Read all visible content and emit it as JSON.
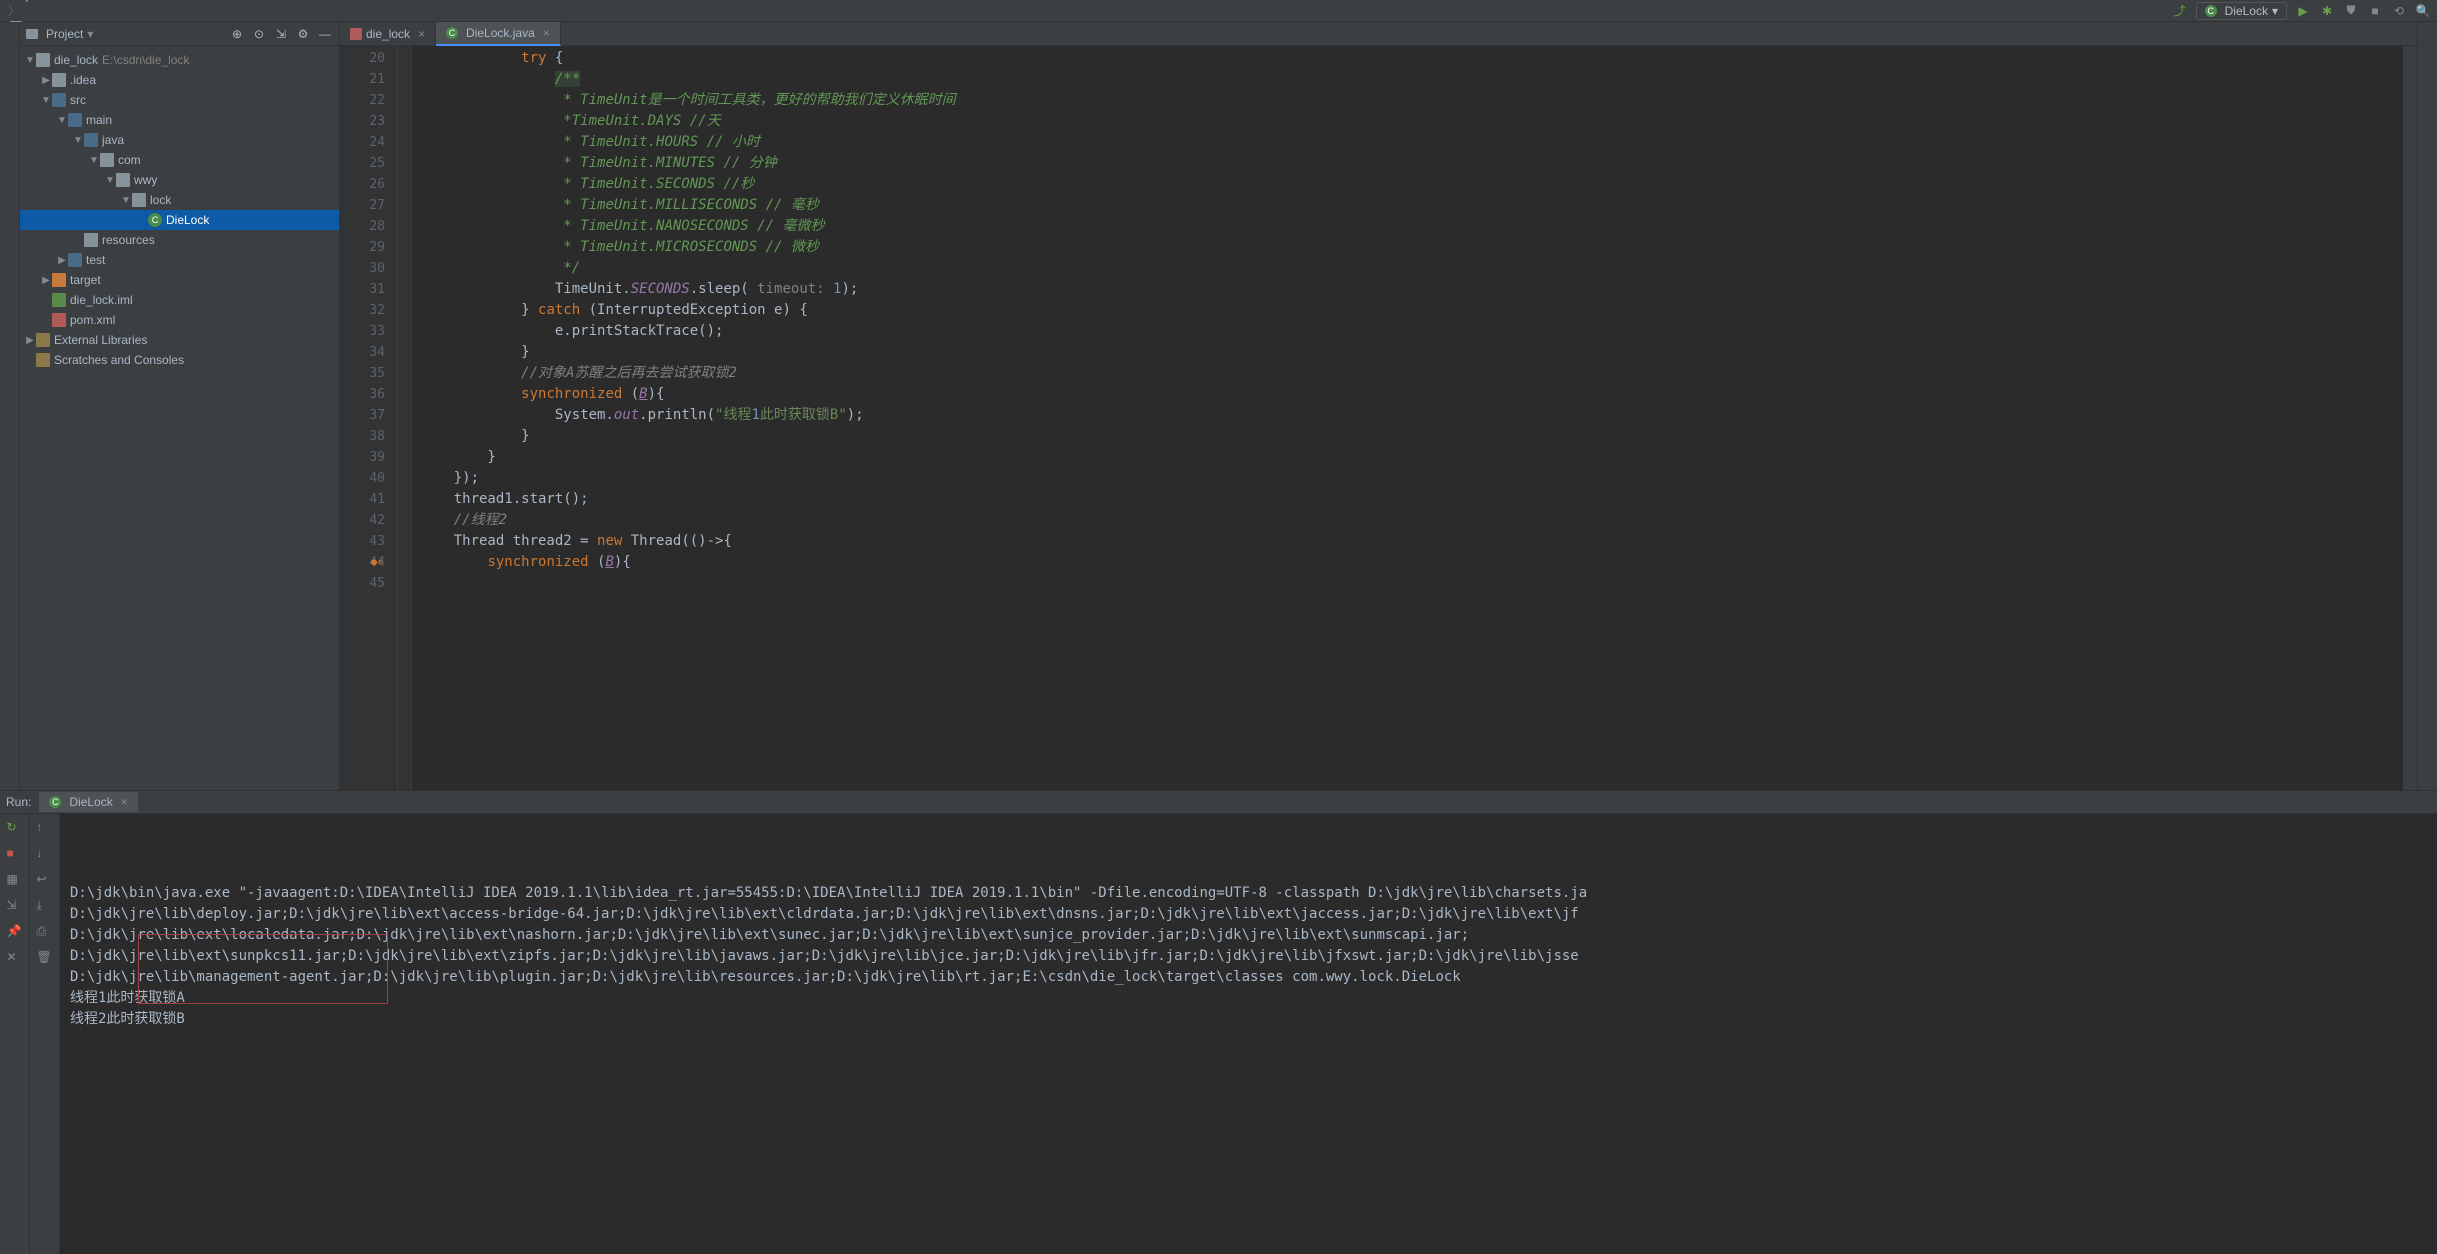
{
  "breadcrumbs": [
    "die_lock",
    "src",
    "main",
    "java",
    "com",
    "wwy",
    "lock",
    "DieLock"
  ],
  "run_config": "DieLock",
  "project_panel": {
    "title": "Project",
    "root_label": "die_lock",
    "root_path": "E:\\csdn\\die_lock",
    "tree": [
      {
        "indent": 1,
        "arrow": "▶",
        "icon": "folder",
        "label": ".idea"
      },
      {
        "indent": 1,
        "arrow": "▼",
        "icon": "folder-blue",
        "label": "src"
      },
      {
        "indent": 2,
        "arrow": "▼",
        "icon": "folder-blue",
        "label": "main"
      },
      {
        "indent": 3,
        "arrow": "▼",
        "icon": "folder-blue",
        "label": "java"
      },
      {
        "indent": 4,
        "arrow": "▼",
        "icon": "folder",
        "label": "com"
      },
      {
        "indent": 5,
        "arrow": "▼",
        "icon": "folder",
        "label": "wwy"
      },
      {
        "indent": 6,
        "arrow": "▼",
        "icon": "folder",
        "label": "lock"
      },
      {
        "indent": 7,
        "arrow": "",
        "icon": "class",
        "label": "DieLock",
        "selected": true
      },
      {
        "indent": 3,
        "arrow": "",
        "icon": "folder",
        "label": "resources"
      },
      {
        "indent": 2,
        "arrow": "▶",
        "icon": "folder-blue",
        "label": "test"
      },
      {
        "indent": 1,
        "arrow": "▶",
        "icon": "orange",
        "label": "target"
      },
      {
        "indent": 1,
        "arrow": "",
        "icon": "file",
        "label": "die_lock.iml"
      },
      {
        "indent": 1,
        "arrow": "",
        "icon": "maven",
        "label": "pom.xml"
      },
      {
        "indent": 0,
        "arrow": "▶",
        "icon": "lib",
        "label": "External Libraries"
      },
      {
        "indent": 0,
        "arrow": "",
        "icon": "lib",
        "label": "Scratches and Consoles"
      }
    ]
  },
  "tabs": {
    "tab1": "die_lock",
    "tab2": "DieLock.java"
  },
  "code": {
    "first_line": 20,
    "lines": [
      "            try {",
      "                /**",
      "                 * TimeUnit是一个时间工具类，更好的帮助我们定义休眠时间",
      "                 *TimeUnit.DAYS //天",
      "                 * TimeUnit.HOURS // 小时",
      "                 * TimeUnit.MINUTES // 分钟",
      "                 * TimeUnit.SECONDS //秒",
      "                 * TimeUnit.MILLISECONDS // 毫秒",
      "                 * TimeUnit.NANOSECONDS // 毫微秒",
      "                 * TimeUnit.MICROSECONDS // 微秒",
      "                 */",
      "                TimeUnit.SECONDS.sleep( timeout: 1);",
      "            } catch (InterruptedException e) {",
      "                e.printStackTrace();",
      "            }",
      "            //对象A苏醒之后再去尝试获取锁2",
      "            synchronized (B){",
      "                System.out.println(\"线程1此时获取锁B\");",
      "            }",
      "        }",
      "    });",
      "",
      "    thread1.start();",
      "    //线程2",
      "    Thread thread2 = new Thread(()->{",
      "        synchronized (B){"
    ]
  },
  "run": {
    "label": "Run:",
    "tab": "DieLock",
    "output": [
      "D:\\jdk\\bin\\java.exe \"-javaagent:D:\\IDEA\\IntelliJ IDEA 2019.1.1\\lib\\idea_rt.jar=55455:D:\\IDEA\\IntelliJ IDEA 2019.1.1\\bin\" -Dfile.encoding=UTF-8 -classpath D:\\jdk\\jre\\lib\\charsets.ja",
      "D:\\jdk\\jre\\lib\\deploy.jar;D:\\jdk\\jre\\lib\\ext\\access-bridge-64.jar;D:\\jdk\\jre\\lib\\ext\\cldrdata.jar;D:\\jdk\\jre\\lib\\ext\\dnsns.jar;D:\\jdk\\jre\\lib\\ext\\jaccess.jar;D:\\jdk\\jre\\lib\\ext\\jf",
      "D:\\jdk\\jre\\lib\\ext\\localedata.jar;D:\\jdk\\jre\\lib\\ext\\nashorn.jar;D:\\jdk\\jre\\lib\\ext\\sunec.jar;D:\\jdk\\jre\\lib\\ext\\sunjce_provider.jar;D:\\jdk\\jre\\lib\\ext\\sunmscapi.jar;",
      "D:\\jdk\\jre\\lib\\ext\\sunpkcs11.jar;D:\\jdk\\jre\\lib\\ext\\zipfs.jar;D:\\jdk\\jre\\lib\\javaws.jar;D:\\jdk\\jre\\lib\\jce.jar;D:\\jdk\\jre\\lib\\jfr.jar;D:\\jdk\\jre\\lib\\jfxswt.jar;D:\\jdk\\jre\\lib\\jsse",
      "D:\\jdk\\jre\\lib\\management-agent.jar;D:\\jdk\\jre\\lib\\plugin.jar;D:\\jdk\\jre\\lib\\resources.jar;D:\\jdk\\jre\\lib\\rt.jar;E:\\csdn\\die_lock\\target\\classes com.wwy.lock.DieLock",
      "线程1此时获取锁A",
      "线程2此时获取锁B"
    ]
  }
}
